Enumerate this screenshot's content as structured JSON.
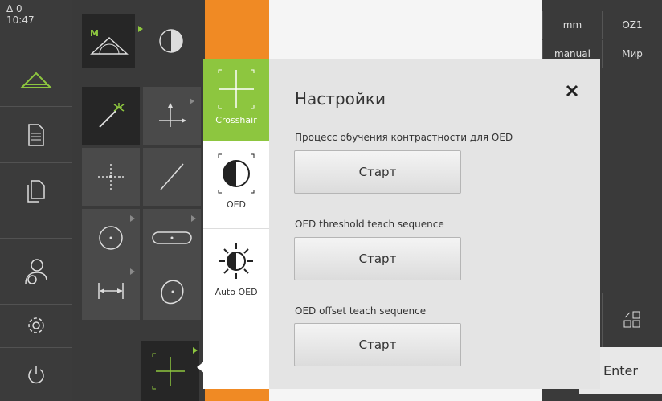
{
  "status": {
    "delta": "Δ 0",
    "time": "10:47"
  },
  "nav": {
    "items": [
      "measure-icon",
      "report-icon",
      "files-icon",
      "user-settings-icon",
      "settings-icon",
      "power-icon"
    ]
  },
  "palette": {
    "tools": [
      "auto-measure",
      "contrast",
      "magic-wand",
      "point-measure",
      "point",
      "line",
      "circle",
      "slot",
      "distance",
      "freeform",
      "crosshair-current"
    ]
  },
  "right_panel": {
    "unit": "mm",
    "coord_system": "OZ1",
    "mode": "manual",
    "frame": "Мир",
    "enter_label": "Enter"
  },
  "dialog": {
    "tabs": [
      {
        "label": "Crosshair",
        "icon": "crosshair-icon",
        "selected": true
      },
      {
        "label": "OED",
        "icon": "oed-icon",
        "selected": false
      },
      {
        "label": "Auto OED",
        "icon": "auto-oed-icon",
        "selected": false
      }
    ],
    "title": "Настройки",
    "sections": [
      {
        "label": "Процесс обучения контрастности для OED",
        "button": "Старт"
      },
      {
        "label": "OED threshold teach sequence",
        "button": "Старт"
      },
      {
        "label": "OED offset teach sequence",
        "button": "Старт"
      }
    ]
  },
  "colors": {
    "accent": "#8dc63f",
    "orange": "#f08a24",
    "dark": "#3a3a3a"
  }
}
